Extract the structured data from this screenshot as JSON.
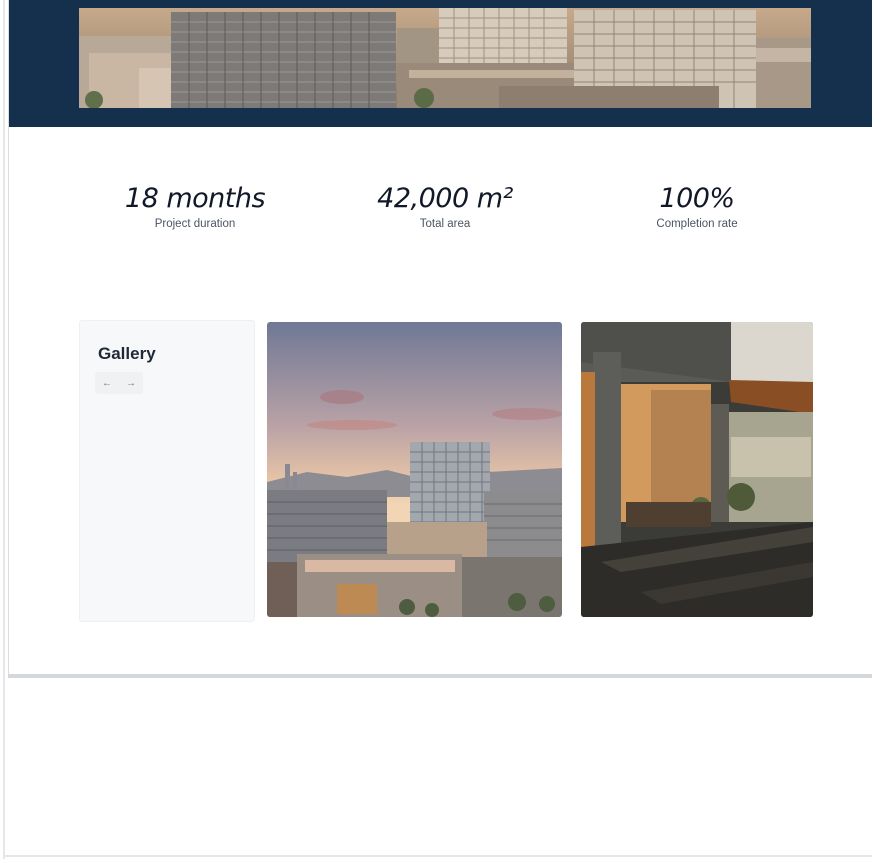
{
  "stats": [
    {
      "value": "18 months",
      "label": "Project duration"
    },
    {
      "value": "42,000 m²",
      "label": "Total area"
    },
    {
      "value": "100%",
      "label": "Completion rate"
    }
  ],
  "gallery": {
    "title": "Gallery",
    "prev_icon": "←",
    "next_icon": "→"
  },
  "colors": {
    "hero_background": "#14304d",
    "page_background": "#ffffff",
    "gallery_card_background": "#f7f8f9"
  },
  "icons": [
    "arrow-left-icon",
    "arrow-right-icon"
  ]
}
